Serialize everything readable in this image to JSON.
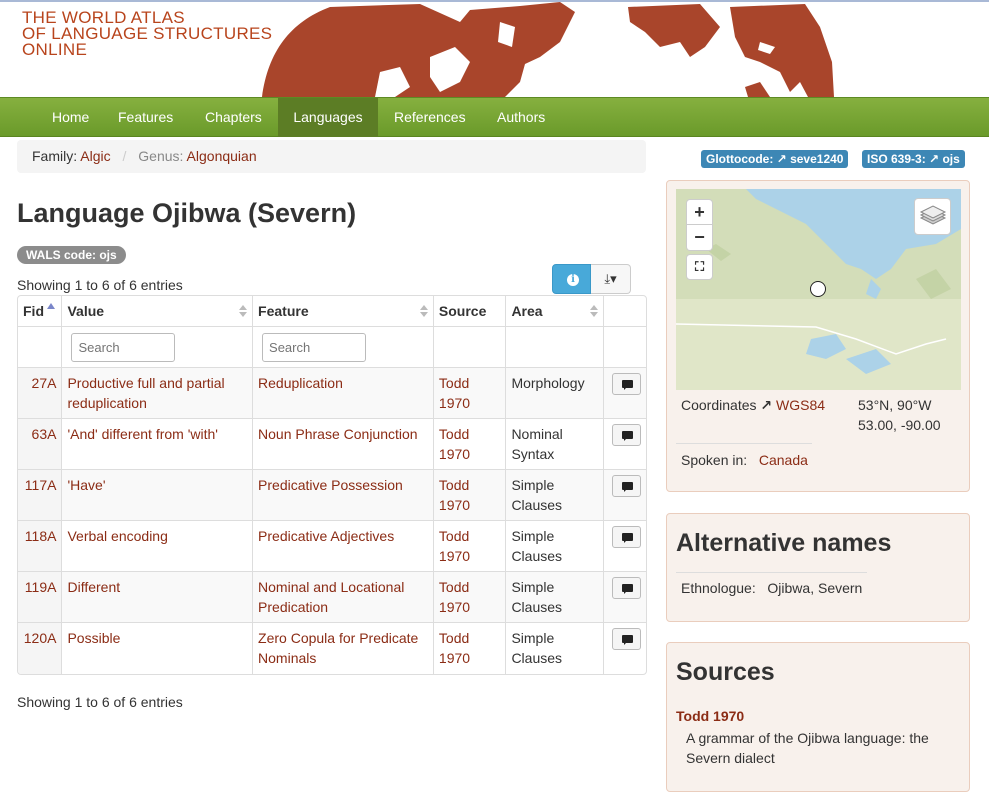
{
  "header": {
    "logo_lines": [
      "THE WORLD ATLAS",
      "OF LANGUAGE STRUCTURES",
      "ONLINE"
    ]
  },
  "nav": {
    "items": [
      "Home",
      "Features",
      "Chapters",
      "Languages",
      "References",
      "Authors"
    ],
    "active": "Languages"
  },
  "breadcrumb": {
    "family_label": "Family:",
    "family_value": "Algic",
    "genus_label": "Genus:",
    "genus_value": "Algonquian"
  },
  "badges": {
    "glottocode": "Glottocode: ",
    "glottocode_value": "seve1240",
    "iso": "ISO 639-3: ",
    "iso_value": "ojs"
  },
  "page": {
    "title": "Language Ojibwa (Severn)",
    "wals_code": "WALS code: ojs",
    "showing_top": "Showing 1 to 6 of 6 entries",
    "showing_bottom": "Showing 1 to 6 of 6 entries"
  },
  "table": {
    "headers": [
      "Fid",
      "Value",
      "Feature",
      "Source",
      "Area"
    ],
    "search_placeholder": "Search",
    "rows": [
      {
        "fid": "27A",
        "value": "Productive full and partial reduplication",
        "feature": "Reduplication",
        "source": "Todd 1970",
        "area": "Morphology"
      },
      {
        "fid": "63A",
        "value": "'And' different from 'with'",
        "feature": "Noun Phrase Conjunction",
        "source": "Todd 1970",
        "area": "Nominal Syntax"
      },
      {
        "fid": "117A",
        "value": "'Have'",
        "feature": "Predicative Possession",
        "source": "Todd 1970",
        "area": "Simple Clauses"
      },
      {
        "fid": "118A",
        "value": "Verbal encoding",
        "feature": "Predicative Adjectives",
        "source": "Todd 1970",
        "area": "Simple Clauses"
      },
      {
        "fid": "119A",
        "value": "Different",
        "feature": "Nominal and Locational Predication",
        "source": "Todd 1970",
        "area": "Simple Clauses"
      },
      {
        "fid": "120A",
        "value": "Possible",
        "feature": "Zero Copula for Predicate Nominals",
        "source": "Todd 1970",
        "area": "Simple Clauses"
      }
    ]
  },
  "map_panel": {
    "zoom_in": "+",
    "zoom_out": "−",
    "coordinates_label": "Coordinates",
    "datum": "WGS84",
    "coords_dms": "53°N, 90°W",
    "coords_dec": "53.00, -90.00",
    "spoken_in_label": "Spoken in:",
    "spoken_in_value": "Canada"
  },
  "alt_names": {
    "title": "Alternative names",
    "label": "Ethnologue:",
    "value": "Ojibwa, Severn"
  },
  "sources": {
    "title": "Sources",
    "ref": "Todd 1970",
    "desc": "A grammar of the Ojibwa language: the Severn dialect"
  },
  "colors": {
    "brand": "#b8441c",
    "navbar": "#76a535",
    "link": "#8b2c15",
    "badge": "#3d87b5"
  }
}
